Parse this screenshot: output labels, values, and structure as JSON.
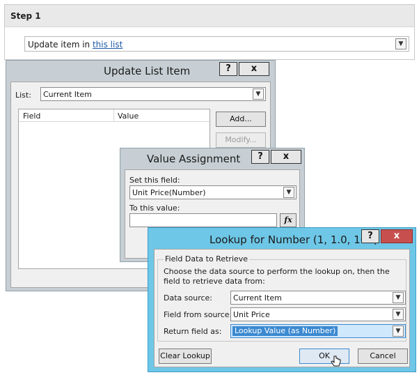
{
  "step": {
    "title": "Step 1",
    "action_text": "Update item in ",
    "action_link": "this list"
  },
  "update_list_item": {
    "title": "Update List Item",
    "help_label": "?",
    "close_label": "x",
    "list_label": "List:",
    "list_value": "Current Item",
    "columns": [
      "Field",
      "Value"
    ],
    "add_label": "Add...",
    "modify_label": "Modify..."
  },
  "value_assignment": {
    "title": "Value Assignment",
    "help_label": "?",
    "close_label": "x",
    "set_field_label": "Set this field:",
    "field_value": "Unit Price(Number)",
    "to_value_label": "To this value:",
    "to_value": "",
    "fx_label": "fx"
  },
  "lookup": {
    "title": "Lookup for Number (1, 1.0, 100)",
    "help_label": "?",
    "close_label": "x",
    "group_label": "Field Data to Retrieve",
    "description": "Choose the data source to perform the lookup on, then the field to retrieve data from:",
    "data_source_label": "Data source:",
    "data_source_value": "Current Item",
    "field_from_source_label": "Field from source:",
    "field_from_source_value": "Unit Price",
    "return_field_label": "Return field as:",
    "return_field_value": "Lookup Value (as Number)",
    "clear_label": "Clear Lookup",
    "ok_label": "OK",
    "cancel_label": "Cancel"
  },
  "colors": {
    "active_title": "#6ec7e7",
    "inactive_title": "#c7cfd4",
    "close_red": "#c7504f",
    "link": "#1f5aa8",
    "selection": "#3b89d0"
  },
  "icons": [
    "chevron-down-icon",
    "help-icon",
    "close-icon",
    "function-icon",
    "hand-cursor-icon"
  ]
}
